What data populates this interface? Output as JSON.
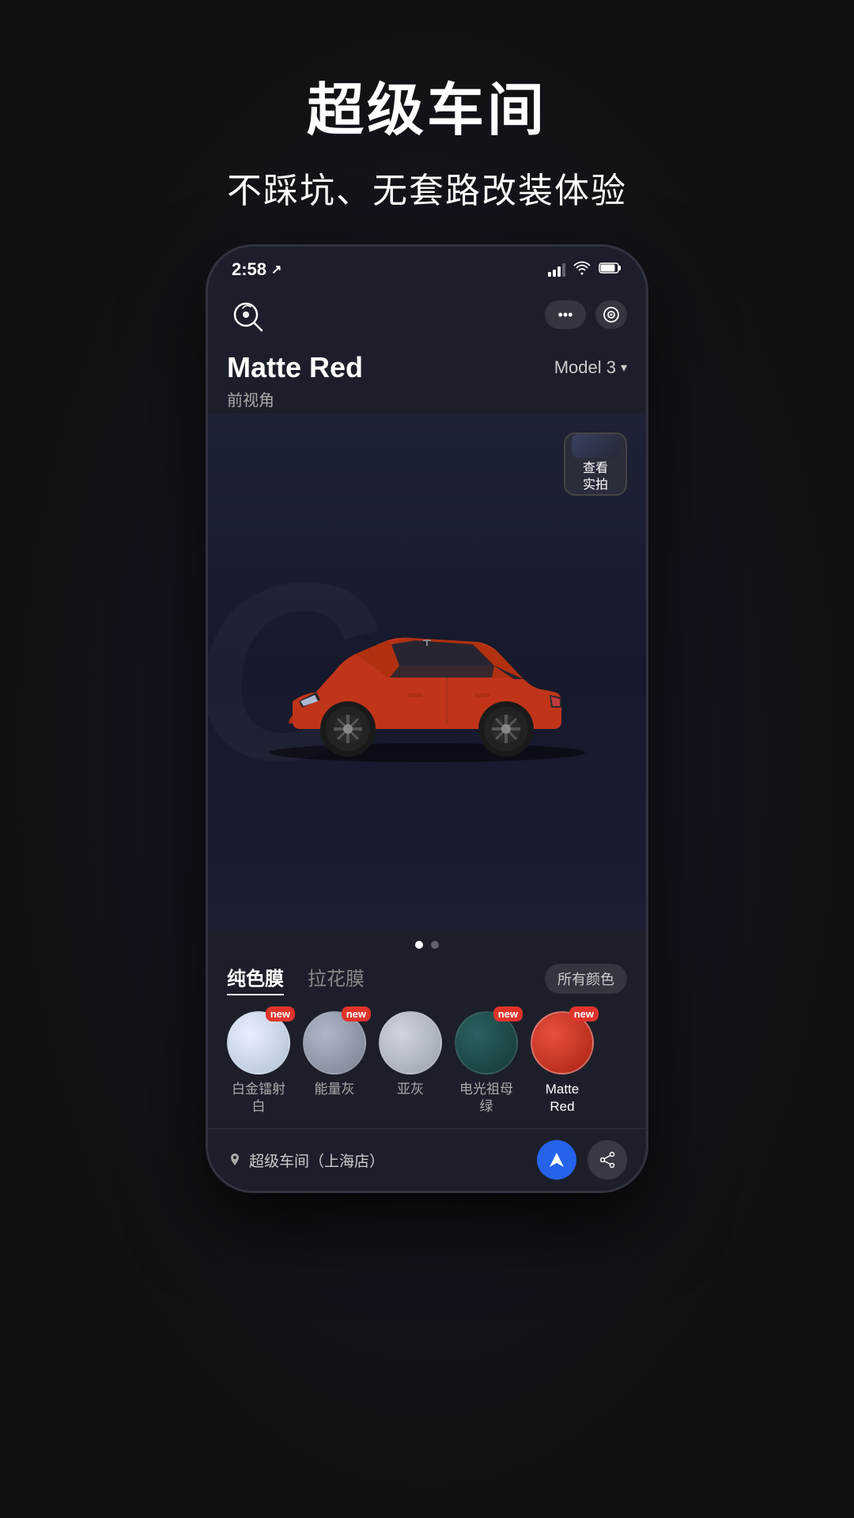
{
  "header": {
    "title": "超级车间",
    "subtitle": "不踩坑、无套路改装体验"
  },
  "statusBar": {
    "time": "2:58",
    "locationArrow": "↗"
  },
  "appBar": {
    "moreLabel": "•••",
    "targetLabel": "⊙"
  },
  "carInfo": {
    "name": "Matte Red",
    "angle": "前视角",
    "modelLabel": "Model 3"
  },
  "realPhotoBtn": {
    "line1": "查看",
    "line2": "实拍"
  },
  "pagination": {
    "dots": [
      "active",
      "inactive"
    ]
  },
  "filmTabs": {
    "tab1": "纯色膜",
    "tab2": "拉花膜",
    "allColors": "所有颜色"
  },
  "colors": [
    {
      "id": "white",
      "label": "白金镭射\n白",
      "labelLine1": "白金镭射",
      "labelLine2": "白",
      "isNew": true,
      "swatch": "swatch-white",
      "isActive": false
    },
    {
      "id": "gray",
      "label": "能量灰",
      "labelLine1": "能量灰",
      "labelLine2": "",
      "isNew": true,
      "swatch": "swatch-gray",
      "isActive": false
    },
    {
      "id": "silver",
      "label": "亚灰",
      "labelLine1": "亚灰",
      "labelLine2": "",
      "isNew": false,
      "swatch": "swatch-silver",
      "isActive": false
    },
    {
      "id": "green",
      "label": "电光祖母\n绿",
      "labelLine1": "电光祖母",
      "labelLine2": "绿",
      "isNew": true,
      "swatch": "swatch-green",
      "isActive": false
    },
    {
      "id": "red",
      "label": "Matte Red",
      "labelLine1": "Matte",
      "labelLine2": "Red",
      "isNew": true,
      "swatch": "swatch-red",
      "isActive": true
    }
  ],
  "bottomBar": {
    "shopName": "超级车间（上海店）"
  }
}
